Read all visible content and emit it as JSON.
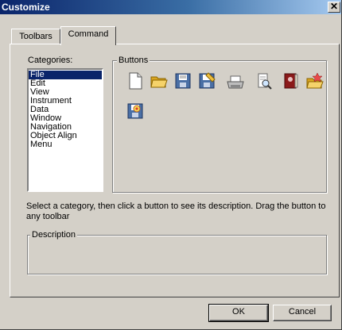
{
  "window": {
    "title": "Customize",
    "close_glyph": "✕"
  },
  "tabs": [
    {
      "label": "Toolbars",
      "active": false
    },
    {
      "label": "Command",
      "active": true
    }
  ],
  "categories": {
    "label": "Categories:",
    "items": [
      "File",
      "Edit",
      "View",
      "Instrument",
      "Data",
      "Window",
      "Navigation",
      "Object Align",
      "Menu"
    ],
    "selected": "File"
  },
  "buttons": {
    "label": "Buttons",
    "icons": [
      "new-file-icon",
      "open-folder-icon",
      "save-icon",
      "save-as-icon",
      "print-icon",
      "print-preview-icon",
      "book-icon",
      "folder-favorite-icon",
      "save-colorful-icon"
    ]
  },
  "hint_text": "Select a category, then click a button to see its description. Drag the button to any toolbar",
  "description": {
    "label": "Description"
  },
  "actions": {
    "ok_label": "OK",
    "cancel_label": "Cancel"
  },
  "colors": {
    "title_bar": "#0a246a",
    "selection": "#0a246a",
    "face": "#d4d0c8"
  }
}
